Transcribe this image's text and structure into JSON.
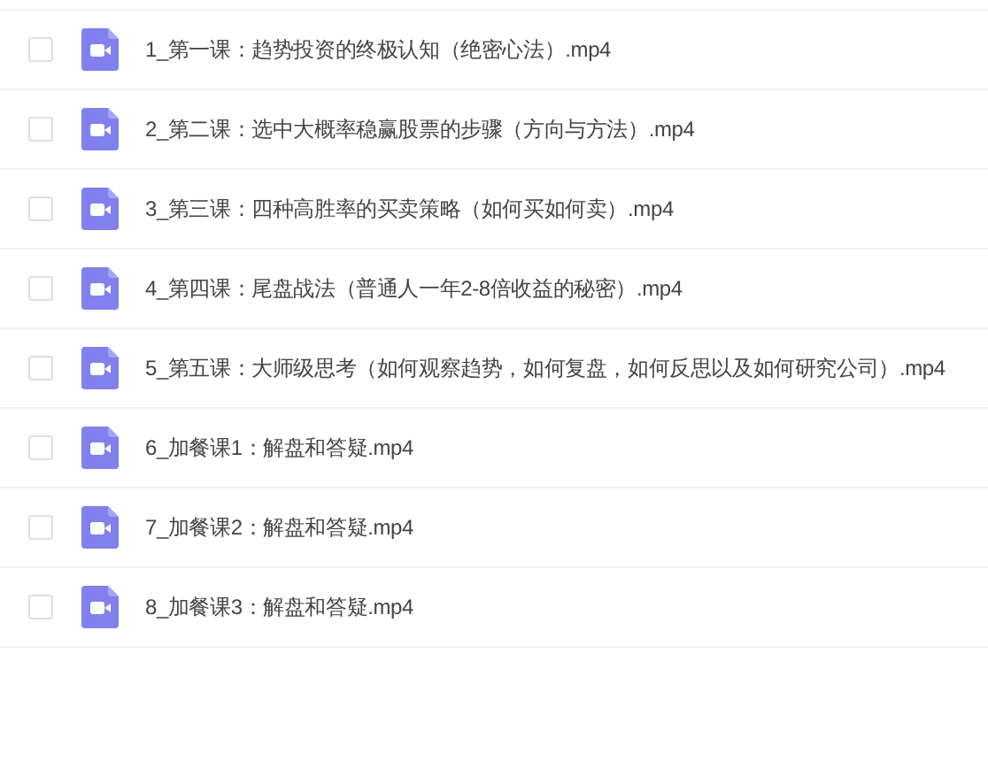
{
  "files": [
    {
      "name": "1_第一课：趋势投资的终极认知（绝密心法）.mp4",
      "checked": false
    },
    {
      "name": "2_第二课：选中大概率稳赢股票的步骤（方向与方法）.mp4",
      "checked": false
    },
    {
      "name": "3_第三课：四种高胜率的买卖策略（如何买如何卖）.mp4",
      "checked": false
    },
    {
      "name": "4_第四课：尾盘战法（普通人一年2-8倍收益的秘密）.mp4",
      "checked": false
    },
    {
      "name": "5_第五课：大师级思考（如何观察趋势，如何复盘，如何反思以及如何研究公司）.mp4",
      "checked": false
    },
    {
      "name": "6_加餐课1：解盘和答疑.mp4",
      "checked": false
    },
    {
      "name": "7_加餐课2：解盘和答疑.mp4",
      "checked": false
    },
    {
      "name": "8_加餐课3：解盘和答疑.mp4",
      "checked": false
    }
  ]
}
